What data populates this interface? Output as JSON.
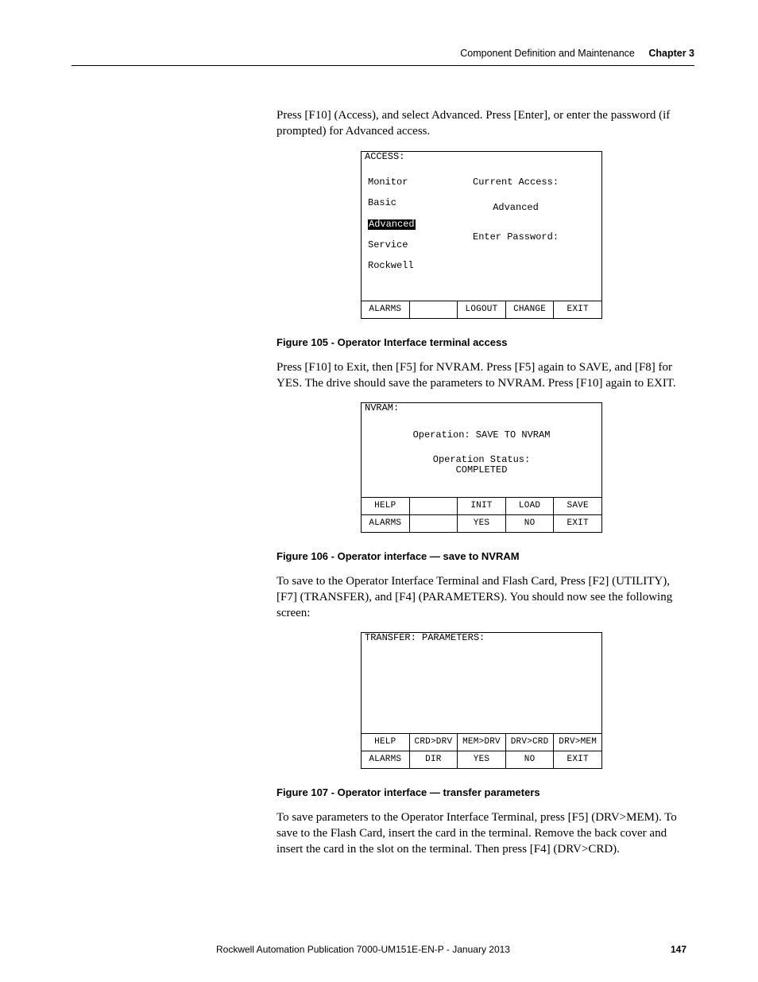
{
  "header": {
    "section": "Component Definition and Maintenance",
    "chapter": "Chapter 3"
  },
  "p1": "Press [F10] (Access), and select Advanced. Press [Enter], or enter the password (if prompted) for Advanced access.",
  "fig105": {
    "caption": "Figure 105 - Operator Interface terminal access",
    "title": "ACCESS:",
    "menu": {
      "i0": "Monitor",
      "i1": "Basic",
      "i2": "Advanced",
      "i3": "Service",
      "i4": "Rockwell"
    },
    "ca_lbl": "Current Access:",
    "ca_val": "Advanced",
    "pw_lbl": "Enter Password:",
    "sk": {
      "c0": "ALARMS",
      "c1": "",
      "c2": "LOGOUT",
      "c3": "CHANGE",
      "c4": "EXIT"
    }
  },
  "p2": "Press [F10] to Exit, then [F5] for NVRAM. Press [F5] again to SAVE, and [F8] for YES. The drive should save the parameters to NVRAM. Press [F10] again to EXIT.",
  "fig106": {
    "caption": "Figure 106 - Operator interface — save to NVRAM",
    "title": "NVRAM:",
    "op_lbl": "Operation:",
    "op_val": "SAVE TO NVRAM",
    "st_lbl": "Operation Status:",
    "st_val": "COMPLETED",
    "sk_top": {
      "c0": "HELP",
      "c1": "",
      "c2": "INIT",
      "c3": "LOAD",
      "c4": "SAVE"
    },
    "sk_bottom": {
      "c0": "ALARMS",
      "c1": "",
      "c2": "YES",
      "c3": "NO",
      "c4": "EXIT"
    }
  },
  "p3": "To save to the Operator Interface Terminal and Flash Card, Press [F2] (UTILITY), [F7] (TRANSFER), and [F4] (PARAMETERS). You should now see the following screen:",
  "fig107": {
    "caption": "Figure 107 - Operator interface — transfer parameters",
    "title": "TRANSFER: PARAMETERS:",
    "sk_top": {
      "c0": "HELP",
      "c1": "CRD>DRV",
      "c2": "MEM>DRV",
      "c3": "DRV>CRD",
      "c4": "DRV>MEM"
    },
    "sk_bottom": {
      "c0": "ALARMS",
      "c1": "DIR",
      "c2": "YES",
      "c3": "NO",
      "c4": "EXIT"
    }
  },
  "p4": "To save parameters to the Operator Interface Terminal, press [F5] (DRV>MEM). To save to the Flash Card, insert the card in the terminal. Remove the back cover and insert the card in the slot on the terminal. Then press [F4] (DRV>CRD).",
  "footer": {
    "pub": "Rockwell Automation Publication 7000-UM151E-EN-P - January 2013",
    "page": "147"
  }
}
